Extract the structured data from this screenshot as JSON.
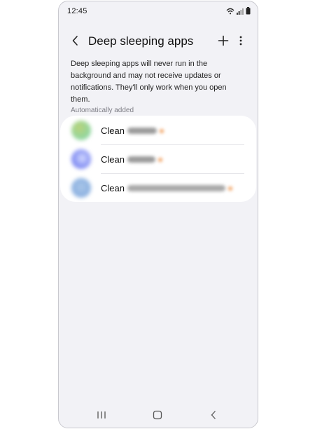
{
  "status_bar": {
    "time": "12:45",
    "icons": [
      "wifi-icon",
      "signal-icon",
      "battery-icon"
    ]
  },
  "header": {
    "back_icon": "chevron-left-icon",
    "title": "Deep sleeping apps",
    "add_icon": "plus-icon",
    "more_icon": "more-vertical-icon"
  },
  "description": "Deep sleeping apps will never run in the background and may not receive updates or notifications. They'll only work when you open them.",
  "section": {
    "label": "Automatically added"
  },
  "apps": [
    {
      "name": "Clean",
      "icon_colors": [
        "#8fd6a2",
        "#b9d37a"
      ]
    },
    {
      "name": "Clean",
      "icon_colors": [
        "#6f7cf0",
        "#b7c6ff"
      ]
    },
    {
      "name": "Clean",
      "icon_colors": [
        "#88aee0",
        "#a9c6e8"
      ]
    }
  ],
  "nav": {
    "recents_icon": "recents-icon",
    "home_icon": "home-icon",
    "back_icon": "back-icon"
  },
  "colors": {
    "background": "#f2f2f6",
    "card": "#ffffff",
    "text": "#111111",
    "secondary_text": "#7d7d85"
  }
}
